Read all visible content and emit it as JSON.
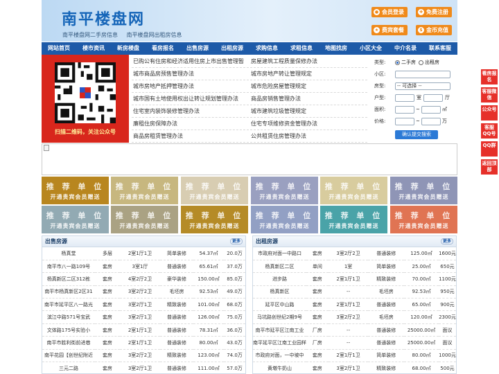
{
  "header": {
    "title": "南平楼盘网",
    "sub_links": [
      "南平楼盘网二手房信息",
      "南平楼盘网出租房信息"
    ],
    "buttons": [
      "会员登录",
      "免费注册",
      "费宾套餐",
      "金币充值"
    ]
  },
  "nav": [
    "网站首页",
    "楼市资讯",
    "新房楼盘",
    "看房报名",
    "出售房源",
    "出租房源",
    "求购信息",
    "求租信息",
    "地图找房",
    "小区大全",
    "中介名录",
    "联系客服"
  ],
  "qr": {
    "caption": "扫描二维码，关注公众号"
  },
  "links": [
    [
      "已购公有住房和经济适用住房上市出售管理暂",
      "房屋建筑工程质量保修办法"
    ],
    [
      "城市商品房预售管理办法",
      "城市房地产转让管理规定"
    ],
    [
      "城市房地产抵押管理办法",
      "城市危险房屋管理规定"
    ],
    [
      "城市国有土地使用权出让转让规划管理办法",
      "商品房销售管理办法"
    ],
    [
      "住宅室内装饰装修管理办法",
      "城市建筑垃圾管理规定"
    ],
    [
      "廉租住房保障办法",
      "住宅专项维修资金管理办法"
    ],
    [
      "商品房租赁管理办法",
      "公共租赁住房管理办法"
    ]
  ],
  "search": {
    "type_label": "类型:",
    "type_options": [
      "二手房",
      "出租房"
    ],
    "community_label": "小区:",
    "housetype_label": "房型:",
    "housetype_value": "-- 可选择 --",
    "layout_label": "户型:",
    "room_unit": "室",
    "hall_unit": "厅",
    "area_label": "面积:",
    "area_unit": "㎡",
    "price_label": "价格:",
    "price_unit": "万",
    "range_sep": "~",
    "submit": "确认提交搜索"
  },
  "tiles": {
    "line1": "推 荐 单 位",
    "line2": "开通贵宾会员赠送"
  },
  "tile_colors": [
    "#b8861f",
    "#c7b77f",
    "#d8cdb2",
    "#9aa0c0",
    "#d8cc9e",
    "#8f95b6",
    "#92aab3",
    "#aaa283",
    "#b58b27",
    "#92a0c4",
    "#4aa3a8",
    "#e07453"
  ],
  "sale": {
    "title": "出售房源",
    "more": "更多",
    "rows": [
      [
        "杨真堂",
        "多层",
        "2室1厅1卫",
        "简单装修",
        "54.37㎡",
        "20.0万"
      ],
      [
        "南平市八一路109号",
        "套房",
        "3室1厅",
        "普通装修",
        "65.61㎡",
        "37.0万"
      ],
      [
        "杨真新区二区312栋",
        "套房",
        "4室2厅2卫",
        "豪华装修",
        "150.00㎡",
        "85.0万"
      ],
      [
        "南平市杨真新区2区31",
        "套房",
        "3室2厅2卫",
        "毛坯房",
        "92.53㎡",
        "49.0万"
      ],
      [
        "南平市延平区八一路光",
        "套房",
        "3室2厅1卫",
        "精致装修",
        "101.00㎡",
        "68.0万"
      ],
      [
        "滨江中路571号宝武",
        "套房",
        "3室2厅1卫",
        "普通装修",
        "126.00㎡",
        "75.0万"
      ],
      [
        "文体路175号实验小",
        "套房",
        "2室1厅1卫",
        "普通装修",
        "78.31㎡",
        "36.0万"
      ],
      [
        "南平市胜利街前进巷",
        "套房",
        "2室1厅1卫",
        "普通装修",
        "80.00㎡",
        "43.0万"
      ],
      [
        "南平花园【创世纪附近",
        "套房",
        "3室2厅2卫",
        "精致装修",
        "123.00㎡",
        "74.0万"
      ],
      [
        "三元二路",
        "套房",
        "3室2厅1卫",
        "普通装修",
        "111.00㎡",
        "57.0万"
      ]
    ]
  },
  "rent": {
    "title": "出租房源",
    "more": "更多",
    "rows": [
      [
        "市政府对面一中路口",
        "套房",
        "3室2厅2卫",
        "普通装修",
        "125.00㎡",
        "1600元"
      ],
      [
        "杨真新区二区",
        "单间",
        "1室",
        "简单装修",
        "25.00㎡",
        "650元"
      ],
      [
        "进步路",
        "套房",
        "2室1厅1卫",
        "精致装修",
        "70.00㎡",
        "1100元"
      ],
      [
        "杨真新区",
        "套房",
        "--",
        "毛坯房",
        "92.53㎡",
        "950元"
      ],
      [
        "延平区中山路",
        "套房",
        "2室1厅1卫",
        "普通装修",
        "65.00㎡",
        "900元"
      ],
      [
        "马坑路创世纪2期9号",
        "套房",
        "3室2厅2卫",
        "毛坯房",
        "120.00㎡",
        "2300元"
      ],
      [
        "南平市延平区江南工业",
        "厂房",
        "--",
        "普通装修",
        "25000.00㎡",
        "面议"
      ],
      [
        "南平延平区江南工业园样",
        "厂房",
        "--",
        "普通装修",
        "25000.00㎡",
        "面议"
      ],
      [
        "市政府对面，一中坡中",
        "套房",
        "2室1厅1卫",
        "简单装修",
        "80.00㎡",
        "1000元"
      ],
      [
        "黄墩牛奶山",
        "套房",
        "3室2厅1卫",
        "精致装修",
        "68.00㎡",
        "500元"
      ]
    ]
  },
  "sidebar": [
    "看房报名",
    "客服微信",
    "公众号",
    "客服QQ号",
    "QQ群",
    "返回顶部"
  ]
}
